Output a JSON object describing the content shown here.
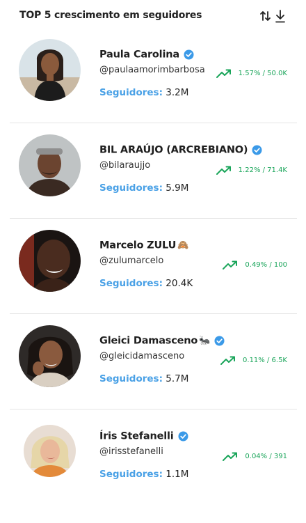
{
  "header": {
    "title": "TOP 5 crescimento em seguidores"
  },
  "colors": {
    "accent_blue": "#4aa1e6",
    "growth_green": "#1aa55a",
    "verified_blue": "#3b9ae8"
  },
  "influencers": [
    {
      "name": "Paula Carolina",
      "emoji": "",
      "verified": true,
      "handle": "@paulaamorimbarbosa",
      "followers_label": "Seguidores:",
      "followers": "3.2M",
      "growth_icon": "trending-up-icon",
      "growth": "1.57% / 50.0K"
    },
    {
      "name": "BIL ARAÚJO (ARCREBIANO)",
      "emoji": "",
      "verified": true,
      "handle": "@bilaraujjo",
      "followers_label": "Seguidores:",
      "followers": "5.9M",
      "growth_icon": "trending-up-icon",
      "growth": "1.22% / 71.4K"
    },
    {
      "name": "Marcelo ZULU",
      "emoji": "🙈",
      "verified": false,
      "handle": "@zulumarcelo",
      "followers_label": "Seguidores:",
      "followers": "20.4K",
      "growth_icon": "trending-up-icon",
      "growth": "0.49% / 100"
    },
    {
      "name": "Gleici Damasceno",
      "emoji": "🐜",
      "verified": true,
      "handle": "@gleicidamasceno",
      "followers_label": "Seguidores:",
      "followers": "5.7M",
      "growth_icon": "trending-up-icon",
      "growth": "0.11% / 6.5K"
    },
    {
      "name": "Íris Stefanelli",
      "emoji": "",
      "verified": true,
      "handle": "@irisstefanelli",
      "followers_label": "Seguidores:",
      "followers": "1.1M",
      "growth_icon": "trending-up-icon",
      "growth": "0.04% / 391"
    }
  ]
}
